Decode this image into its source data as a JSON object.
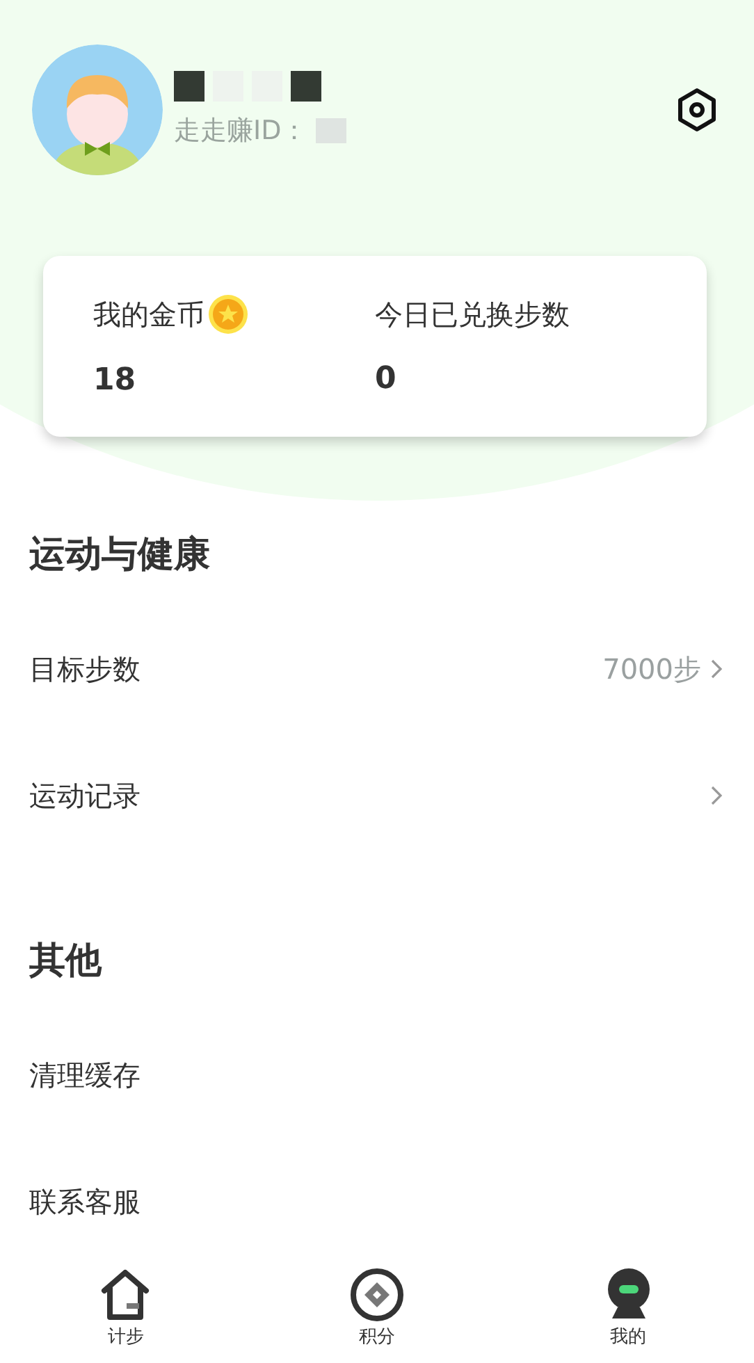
{
  "profile": {
    "id_label": "走走赚ID："
  },
  "stats": [
    {
      "label": "我的金币",
      "value": "18",
      "coin": true
    },
    {
      "label": "今日已兑换步数",
      "value": "0",
      "coin": false
    }
  ],
  "sections": [
    {
      "title": "运动与健康",
      "rows": [
        {
          "label": "目标步数",
          "value": "7000步",
          "chevron": true
        },
        {
          "label": "运动记录",
          "chevron": true
        }
      ]
    },
    {
      "title": "其他",
      "rows": [
        {
          "label": "清理缓存",
          "chevron": false
        },
        {
          "label": "联系客服",
          "chevron": false
        }
      ]
    }
  ],
  "tabs": [
    {
      "label": "计步",
      "kind": "home",
      "selected": false
    },
    {
      "label": "积分",
      "kind": "points",
      "selected": false
    },
    {
      "label": "我的",
      "kind": "me",
      "selected": true
    }
  ]
}
